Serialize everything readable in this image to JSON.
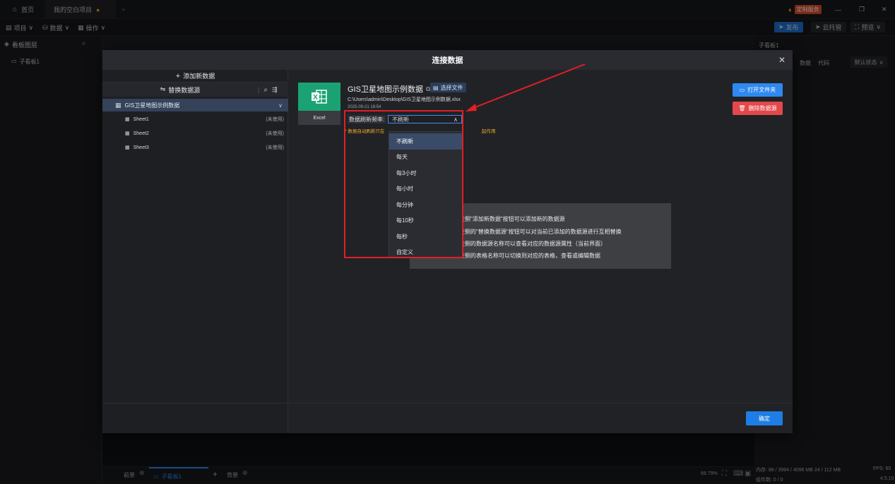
{
  "titlebar": {
    "home_label": "首页",
    "project_tab": "我的空白项目",
    "custom_service": "定制服务",
    "window_controls": [
      "minimize-icon",
      "restore-icon",
      "close-icon"
    ]
  },
  "toolbar": {
    "project": "项目",
    "data": "数据",
    "operate": "操作",
    "publish": "发布",
    "cloud_host": "云托管",
    "preview": "预览"
  },
  "left_panel": {
    "title": "看板图层",
    "layer_item": "子看板1"
  },
  "right_panel": {
    "panel_title": "子看板1",
    "tabs": [
      "数据",
      "代码"
    ],
    "state_select": "默认状态"
  },
  "bottom_bar": {
    "front_label": "前景",
    "board_tab": "子看板1",
    "back_label": "背景",
    "zoom": "69.79%",
    "memory": "内存: 88 / 3994 / 4096 MB  24 / 112 MB",
    "fps": "FPS: 60",
    "component_count": "组件数: 0 / 0",
    "version": "4.5.10"
  },
  "modal": {
    "title": "连接数据",
    "add_source": "添加新数据",
    "replace_source": "替换数据源",
    "datasource_name": "GIS卫星地图示例数据",
    "sheets": [
      {
        "name": "Sheet1",
        "status": "(未使用)"
      },
      {
        "name": "Sheet2",
        "status": "(未使用)"
      },
      {
        "name": "Sheet3",
        "status": "(未使用)"
      }
    ],
    "file_title": "GIS卫星地图示例数据",
    "select_file": "选择文件",
    "file_path": "C:\\Users\\admin\\Desktop\\GIS卫星地图示例数据.xlsx",
    "file_date": "2025-09-21 18:54",
    "excel_label": "Excel",
    "refresh_label": "数据刷新频率:",
    "refresh_value": "不刷新",
    "warning_start": "* 数据自动刷新只在",
    "warning_end": "起作用",
    "refresh_options": [
      "不刷新",
      "每天",
      "每3小时",
      "每小时",
      "每分钟",
      "每10秒",
      "每秒",
      "自定义"
    ],
    "open_folder": "打开文件夹",
    "delete_source": "删除数据源",
    "confirm": "确定",
    "help_lines": [
      "左侧\"添加新数据\"按钮可以添加新的数据源",
      "左侧的\"替换数据源\"按钮可以对当前已添加的数据源进行互相替换",
      "左侧的数据源名称可以查看对应的数据源属性（当前界面）",
      "左侧的表格名称可以切换到对应的表格，查看或编辑数据"
    ]
  },
  "colors": {
    "accent_blue": "#2e89f0",
    "danger_red": "#e4484a",
    "excel_green": "#1aa273",
    "annotation_red": "#e21f26",
    "warning_yellow": "#f0a92c"
  }
}
